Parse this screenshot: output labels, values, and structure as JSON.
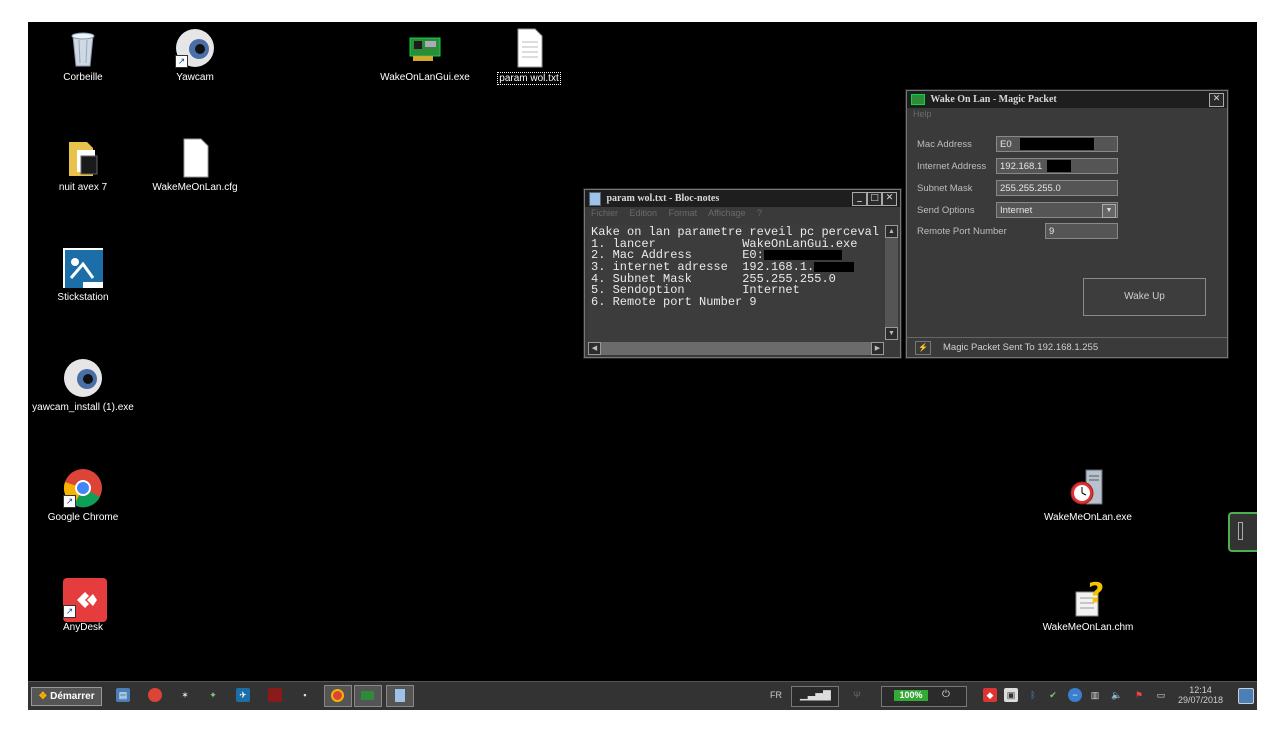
{
  "desktop": {
    "icons": [
      {
        "label": "Corbeille",
        "icon": "recycle-bin-icon"
      },
      {
        "label": "Yawcam",
        "icon": "webcam-eye-icon"
      },
      {
        "label": "WakeOnLanGui.exe",
        "icon": "network-card-icon"
      },
      {
        "label": "param wol.txt",
        "icon": "text-file-icon"
      },
      {
        "label": "nuit avex 7",
        "icon": "folder-icon"
      },
      {
        "label": "WakeMeOnLan.cfg",
        "icon": "blank-file-icon"
      },
      {
        "label": "Stickstation",
        "icon": "stickstation-icon"
      },
      {
        "label": "yawcam_install (1).exe",
        "icon": "webcam-eye-icon"
      },
      {
        "label": "Google Chrome",
        "icon": "chrome-icon"
      },
      {
        "label": "AnyDesk",
        "icon": "anydesk-icon"
      },
      {
        "label": "WakeMeOnLan.exe",
        "icon": "alarm-clock-server-icon"
      },
      {
        "label": "WakeMeOnLan.chm",
        "icon": "help-file-icon"
      }
    ]
  },
  "notepad": {
    "title": "param wol.txt - Bloc-notes",
    "menu": [
      "Fichier",
      "Edition",
      "Format",
      "Affichage",
      "?"
    ],
    "lines": [
      "Kake on lan parametre reveil pc perceval",
      "1. lancer            WakeOnLanGui.exe",
      "2. Mac Address       E0:",
      "3. internet adresse  192.168.1.",
      "4. Subnet Mask       255.255.255.0",
      "5. Sendoption        Internet",
      "6. Remote port Number 9"
    ]
  },
  "wol": {
    "title": "Wake On Lan - Magic Packet",
    "menu": "Help",
    "fields": [
      {
        "label": "Mac Address",
        "value": "E0"
      },
      {
        "label": "Internet Address",
        "value": "192.168.1"
      },
      {
        "label": "Subnet Mask",
        "value": "255.255.255.0"
      },
      {
        "label": "Send Options",
        "value": "Internet"
      },
      {
        "label": "Remote Port Number",
        "value": "9"
      }
    ],
    "wake_button": "Wake Up",
    "status": "Magic Packet Sent To 192.168.1.255"
  },
  "taskbar": {
    "start": "Démarrer",
    "lang": "FR",
    "battery": "100%",
    "time": "12:14",
    "date": "29/07/2018"
  },
  "colors": {
    "desktop": "#000000",
    "taskbar": "#333333",
    "window": "#3a3a3a",
    "edge_handle": "#4caf50"
  }
}
